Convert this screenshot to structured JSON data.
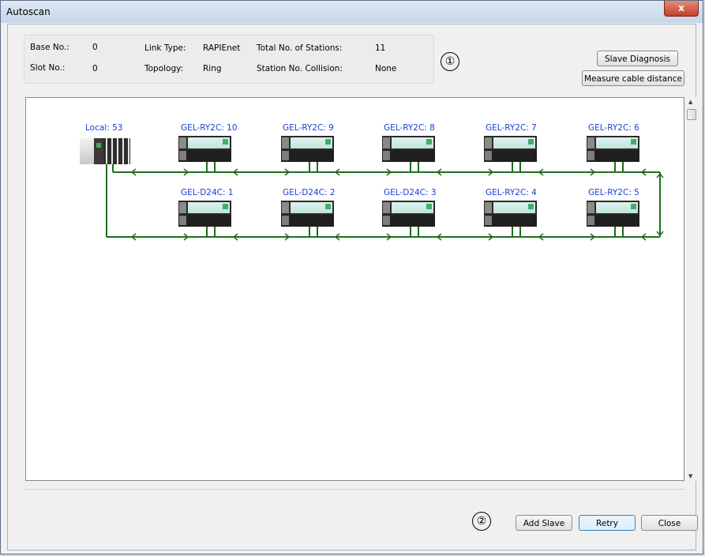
{
  "window": {
    "title": "Autoscan",
    "close_label": "x"
  },
  "info": {
    "base_no_label": "Base No.:",
    "base_no_value": "0",
    "slot_no_label": "Slot No.:",
    "slot_no_value": "0",
    "link_type_label": "Link Type:",
    "link_type_value": "RAPIEnet",
    "topology_label": "Topology:",
    "topology_value": "Ring",
    "total_stations_label": "Total No. of Stations:",
    "total_stations_value": "11",
    "collision_label": "Station No. Collision:",
    "collision_value": "None"
  },
  "markers": {
    "one": "①",
    "two": "②"
  },
  "buttons": {
    "slave_diagnosis": "Slave Diagnosis",
    "measure_cable": "Measure cable distance",
    "add_slave": "Add Slave",
    "retry": "Retry",
    "close": "Close"
  },
  "network": {
    "local": "Local: 53",
    "row1": [
      "GEL-RY2C: 10",
      "GEL-RY2C: 9",
      "GEL-RY2C: 8",
      "GEL-RY2C: 7",
      "GEL-RY2C: 6"
    ],
    "row2": [
      "GEL-D24C: 1",
      "GEL-D24C: 2",
      "GEL-D24C: 3",
      "GEL-RY2C: 4",
      "GEL-RY2C: 5"
    ],
    "line_color": "#1f6e1f"
  }
}
